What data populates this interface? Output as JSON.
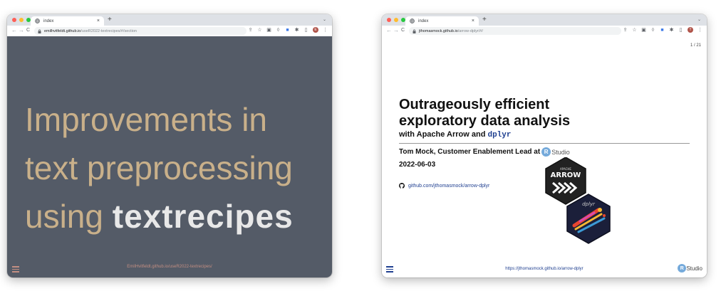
{
  "colors": {
    "dark_slide_bg": "#545b67",
    "title_tan": "#c9b08a",
    "link_blue": "#1f3f90",
    "rstudio_blue": "#75aadb",
    "traffic_red": "#ff5f57",
    "traffic_yellow": "#febc2e",
    "traffic_green": "#28c840"
  },
  "left_window": {
    "tab_title": "index",
    "tab_close": "×",
    "new_tab": "+",
    "tab_menu": "⌄",
    "url_host": "emilhvitfeldt.github.io",
    "url_path": "/useR2022-textrecipes/#/section",
    "slide": {
      "title_line1": "Improvements in",
      "title_line2": "text preprocessing",
      "title_line3_prefix": "using ",
      "title_line3_pkg": "textrecipes",
      "footer": "EmilHvitfeldt.github.io/useR2022-textrecipes/"
    }
  },
  "right_window": {
    "tab_title": "index",
    "tab_close": "×",
    "new_tab": "+",
    "tab_menu": "⌄",
    "url_host": "jthomasmock.github.io",
    "url_path": "/arrow-dplyr/#/",
    "slide": {
      "counter": "1 / 21",
      "title_line1": "Outrageously efficient",
      "title_line2": "exploratory data analysis",
      "subtitle_prefix": "with Apache Arrow and ",
      "subtitle_code": "dplyr",
      "author": "Tom Mock, Customer Enablement Lead at",
      "r_letter": "R",
      "studio": "Studio",
      "date": "2022-06-03",
      "github_link": "github.com/jthomasmock/arrow-dplyr",
      "arrow_hex_small": "APACHE",
      "arrow_hex_big": "ARROW",
      "dplyr_hex": "dplyr",
      "footer_url": "https://jthomasmock.github.io/arrow-dplyr"
    }
  },
  "nav": {
    "back": "←",
    "forward": "→",
    "reload": "C"
  }
}
